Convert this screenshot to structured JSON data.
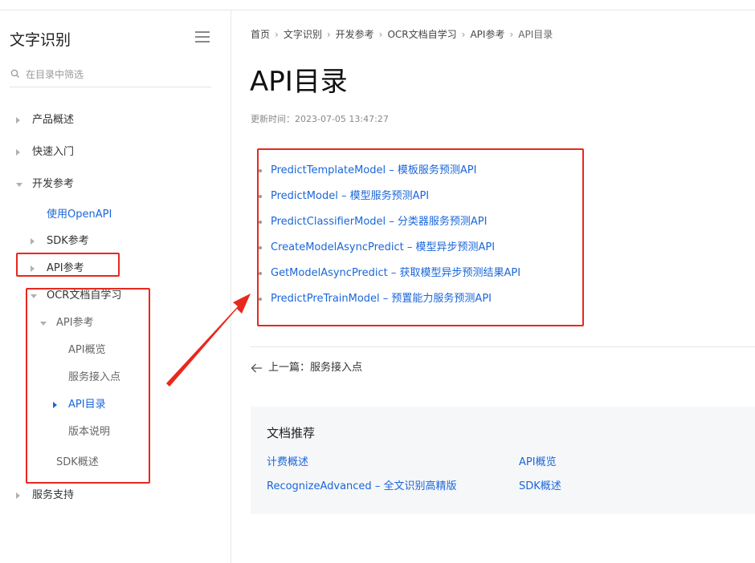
{
  "sidebar": {
    "title": "文字识别",
    "filter_placeholder": "在目录中筛选",
    "items": [
      {
        "label": "产品概述",
        "state": "collapsed"
      },
      {
        "label": "快速入门",
        "state": "collapsed"
      },
      {
        "label": "开发参考",
        "state": "expanded"
      },
      {
        "label": "使用OpenAPI",
        "state": "link-active"
      },
      {
        "label": "SDK参考",
        "state": "collapsed"
      },
      {
        "label": "API参考",
        "state": "collapsed"
      },
      {
        "label": "OCR文档自学习",
        "state": "expanded"
      },
      {
        "label": "API参考",
        "state": "expanded"
      },
      {
        "label": "API概览",
        "state": "leaf"
      },
      {
        "label": "服务接入点",
        "state": "leaf"
      },
      {
        "label": "API目录",
        "state": "current"
      },
      {
        "label": "版本说明",
        "state": "leaf"
      },
      {
        "label": "SDK概述",
        "state": "leaf"
      },
      {
        "label": "服务支持",
        "state": "collapsed"
      }
    ]
  },
  "breadcrumb": [
    "首页",
    "文字识别",
    "开发参考",
    "OCR文档自学习",
    "API参考",
    "API目录"
  ],
  "page": {
    "title": "API目录",
    "updated": "更新时间：2023-07-05 13:47:27"
  },
  "api_links": [
    "PredictTemplateModel – 模板服务预测API",
    "PredictModel – 模型服务预测API",
    "PredictClassifierModel – 分类器服务预测API",
    "CreateModelAsyncPredict – 模型异步预测API",
    "GetModelAsyncPredict – 获取模型异步预测结果API",
    "PredictPreTrainModel – 预置能力服务预测API"
  ],
  "prev_page": {
    "label": "上一篇：服务接入点"
  },
  "recommend": {
    "title": "文档推荐",
    "links": [
      "计费概述",
      "API概览",
      "RecognizeAdvanced – 全文识别高精版",
      "SDK概述"
    ]
  },
  "colors": {
    "link": "#1a66d9",
    "annotation_red": "#e8281e"
  }
}
